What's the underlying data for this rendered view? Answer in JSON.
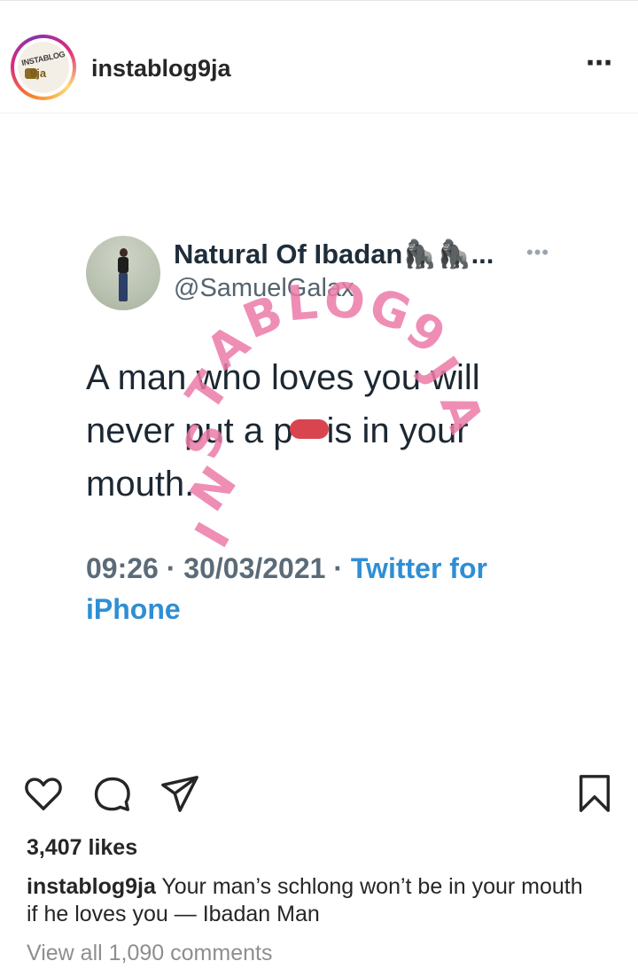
{
  "post": {
    "username": "instablog9ja",
    "avatar_logo_text_1": "INSTABLOG",
    "avatar_logo_text_2": "9ja",
    "more_icon": "more-horizontal-icon"
  },
  "tweet": {
    "display_name": "Natural Of Ibadan🦍🦍...",
    "handle": "@SamuelGalax",
    "more_label": "•••",
    "text_part1": "A man who loves you will never put a p",
    "text_part2": "is in your mouth.",
    "timestamp": "09:26 · 30/03/2021 · ",
    "source": "Twitter for iPhone"
  },
  "watermark": {
    "letters": [
      "I",
      "N",
      "S",
      "T",
      "A",
      "B",
      "L",
      "O",
      "G",
      "9",
      "J",
      "A"
    ]
  },
  "actions": {
    "like_icon": "heart-icon",
    "comment_icon": "comment-icon",
    "share_icon": "send-icon",
    "save_icon": "bookmark-icon"
  },
  "engagement": {
    "likes": "3,407 likes",
    "caption_user": "instablog9ja",
    "caption_text": " Your man’s schlong won’t be in your mouth if he loves you — Ibadan Man",
    "view_comments": "View all 1,090 comments"
  }
}
